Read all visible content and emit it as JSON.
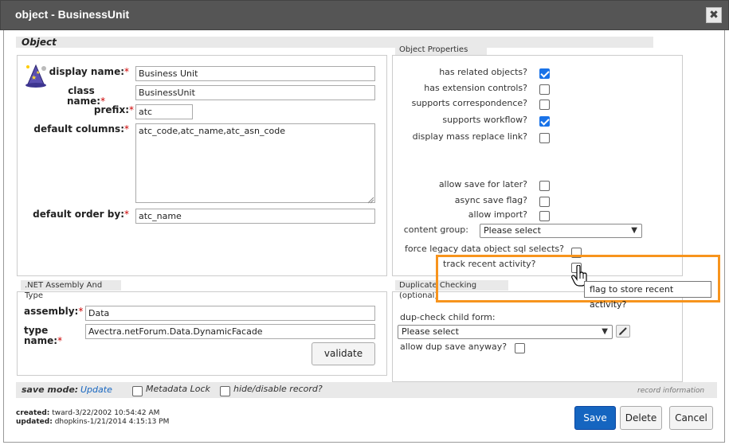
{
  "window": {
    "title": "object - BusinessUnit",
    "close_glyph": "✖"
  },
  "object": {
    "section_label": "Object",
    "icon": "wizard-hat-icon",
    "display_name": {
      "label": "display name:",
      "value": "Business Unit"
    },
    "class_name": {
      "label_line1": "class",
      "label_line2": "name:",
      "value": "BusinessUnit"
    },
    "prefix": {
      "label": "prefix:",
      "value": "atc"
    },
    "default_columns": {
      "label": "default columns:",
      "value": "atc_code,atc_name,atc_asn_code"
    },
    "default_order_by": {
      "label": "default order by:",
      "value": "atc_name"
    }
  },
  "properties": {
    "section_label": "Object Properties",
    "has_related_objects": {
      "label": "has related objects?",
      "checked": true
    },
    "has_extension_controls": {
      "label": "has extension controls?",
      "checked": false
    },
    "supports_correspondence": {
      "label": "supports correspondence?",
      "checked": false
    },
    "supports_workflow": {
      "label": "supports workflow?",
      "checked": true
    },
    "display_mass_replace": {
      "label": "display mass replace link?",
      "checked": false
    },
    "allow_save_later": {
      "label": "allow save for later?",
      "checked": false
    },
    "async_save": {
      "label": "async save flag?",
      "checked": false
    },
    "allow_import": {
      "label": "allow import?",
      "checked": false
    },
    "content_group": {
      "label": "content group:",
      "value": "Please select"
    },
    "force_legacy": {
      "label": "force legacy data object sql selects?",
      "checked": false
    },
    "track_recent": {
      "label": "track recent activity?",
      "checked": false
    },
    "tooltip": "flag to store recent activity?"
  },
  "assembly": {
    "section_label": ".NET Assembly And Type",
    "assembly": {
      "label": "assembly:",
      "value": "Data"
    },
    "type_name": {
      "label_line1": "type",
      "label_line2": "name:",
      "value": "Avectra.netForum.Data.DynamicFacade"
    },
    "validate_label": "validate"
  },
  "dup": {
    "section_label": "Duplicate Checking (optional)",
    "child_form": {
      "label": "dup-check child form:",
      "value": "Please select"
    },
    "allow_dup": {
      "label": "allow dup save anyway?",
      "checked": false
    }
  },
  "footer": {
    "save_mode_label": "save mode:",
    "save_mode_value": "Update",
    "metadata_lock": "Metadata Lock",
    "hide_disable": "hide/disable record?",
    "record_info": "record information",
    "created_label": "created:",
    "created_value": "tward-3/22/2002 10:54:42 AM",
    "updated_label": "updated:",
    "updated_value": "dhopkins-1/21/2014 4:15:13 PM",
    "save": "Save",
    "delete": "Delete",
    "cancel": "Cancel"
  },
  "colors": {
    "highlight": "#f7941d",
    "primary": "#1565c0",
    "check": "#1a73e8"
  }
}
